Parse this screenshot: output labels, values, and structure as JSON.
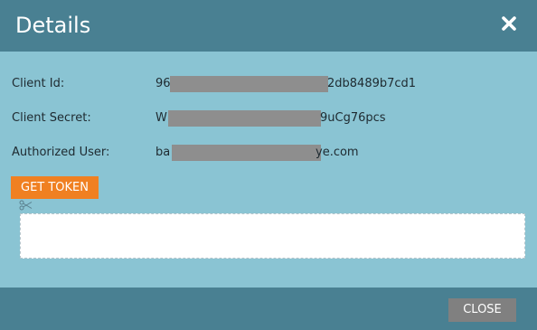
{
  "dialog": {
    "title": "Details",
    "close_icon": "close-x-icon"
  },
  "fields": [
    {
      "label": "Client Id:",
      "value_start": "96",
      "value_end": "2db8489b7cd1"
    },
    {
      "label": "Client Secret:",
      "value_start": "W",
      "value_end": "9uCg76pcs"
    },
    {
      "label": "Authorized User:",
      "value_start": "ba",
      "value_end": "ye.com"
    }
  ],
  "get_token_button": {
    "label": "GET TOKEN"
  },
  "copy_icon": "scissors-icon",
  "token_output": {
    "value": ""
  },
  "footer": {
    "close_label": "CLOSE"
  },
  "colors": {
    "header": "#498092",
    "body": "#8ac4d3",
    "accent_button": "#f08021",
    "close_button": "#808080",
    "redaction": "#8e8e8e"
  }
}
